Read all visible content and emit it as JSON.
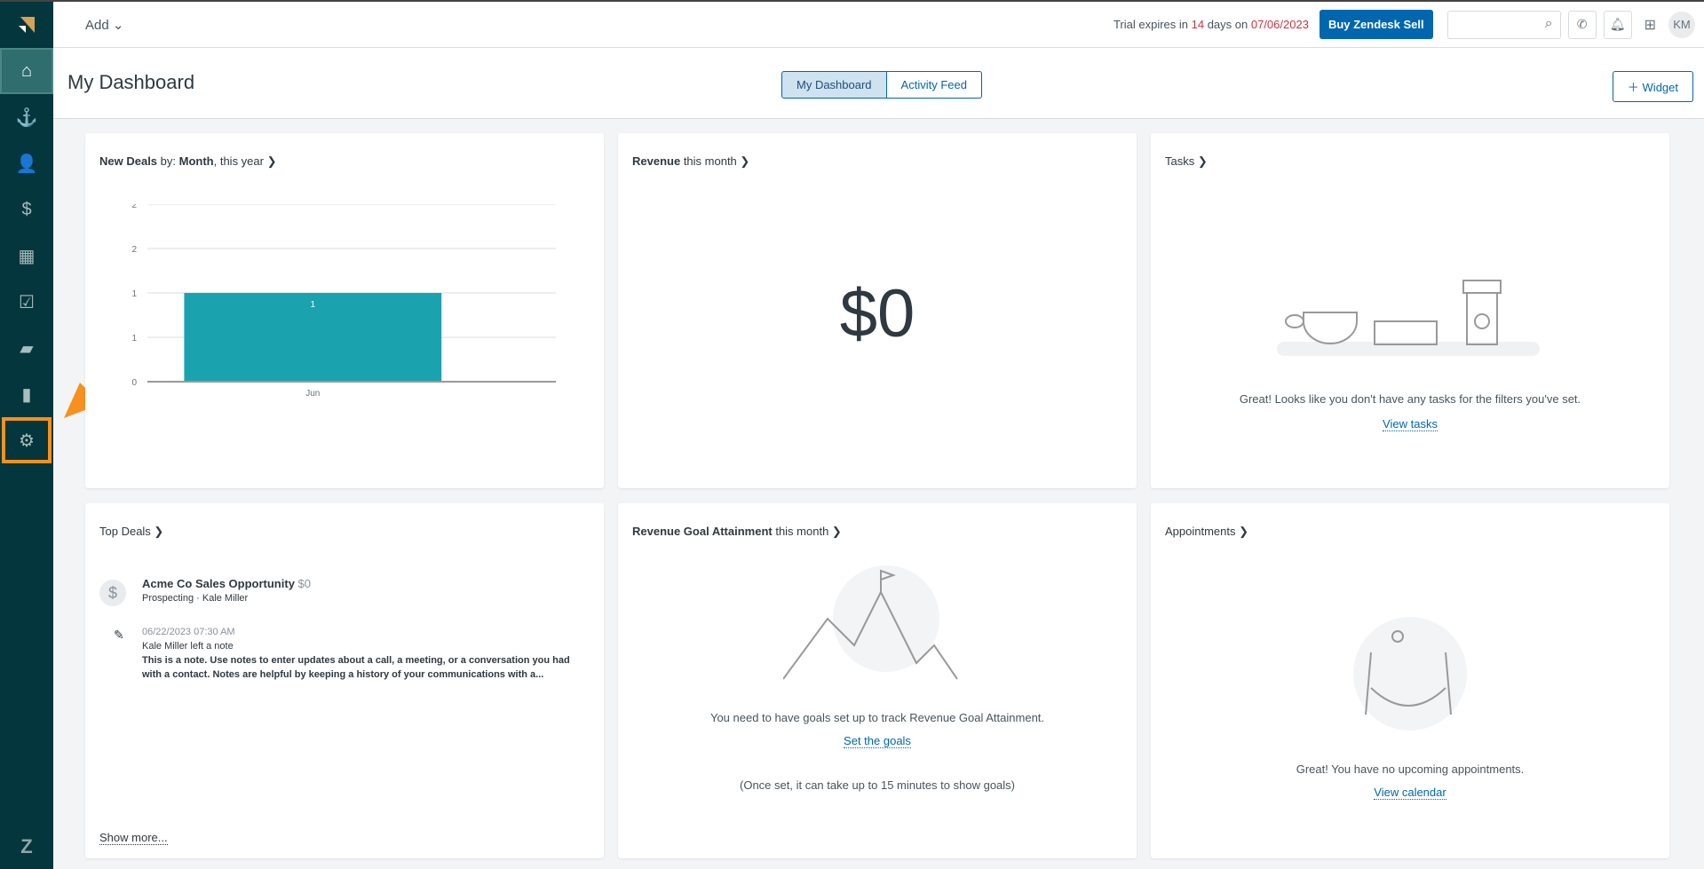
{
  "sidebar": {
    "items": [
      "home",
      "leads",
      "contacts",
      "deals",
      "calendar",
      "tasks",
      "communications",
      "reports",
      "settings"
    ]
  },
  "topbar": {
    "add_label": "Add",
    "trial_prefix": "Trial expires in ",
    "trial_days": "14",
    "trial_mid": " days on ",
    "trial_date": "07/06/2023",
    "buy_label": "Buy Zendesk Sell",
    "search_placeholder": "",
    "avatar": "KM"
  },
  "header": {
    "title": "My Dashboard",
    "tabs": [
      "My Dashboard",
      "Activity Feed"
    ],
    "widget_label": "Widget"
  },
  "new_deals": {
    "title_bold": "New Deals",
    "title_rest": " by: ",
    "title_bold2": "Month",
    "title_rest2": ", this year"
  },
  "chart_data": {
    "type": "bar",
    "categories": [
      "Jun"
    ],
    "values": [
      1
    ],
    "y_ticks": [
      "0",
      "1",
      "1",
      "2",
      "2"
    ],
    "ylim": [
      0,
      2
    ],
    "grid": true,
    "bar_color": "#1aa3af"
  },
  "revenue": {
    "title_bold": "Revenue",
    "title_rest": " this month",
    "value": "$0"
  },
  "tasks": {
    "title": "Tasks",
    "message": "Great! Looks like you don't have any tasks for the filters you've set.",
    "link": "View tasks"
  },
  "top_deals": {
    "title": "Top Deals",
    "deal_name": "Acme Co Sales Opportunity",
    "deal_value": "$0",
    "deal_meta": "Prospecting · Kale Miller",
    "note_time": "06/22/2023 07:30 AM",
    "note_author": "Kale Miller left a note",
    "note_text": "This is a note. Use notes to enter updates about a call, a meeting, or a conversation you had with a contact. Notes are helpful by keeping a history of your communications with a...",
    "show_more": "Show more..."
  },
  "goal": {
    "title_bold": "Revenue Goal Attainment",
    "title_rest": " this month",
    "message": "You need to have goals set up to track Revenue Goal Attainment.",
    "link": "Set the goals",
    "note": "(Once set, it can take up to 15 minutes to show goals)"
  },
  "appointments": {
    "title": "Appointments",
    "message": "Great! You have no upcoming appointments.",
    "link": "View calendar"
  },
  "colors": {
    "sidebar": "#03363d",
    "primary": "#0066ae",
    "highlight": "#f7901e",
    "trial": "#cc3340"
  }
}
